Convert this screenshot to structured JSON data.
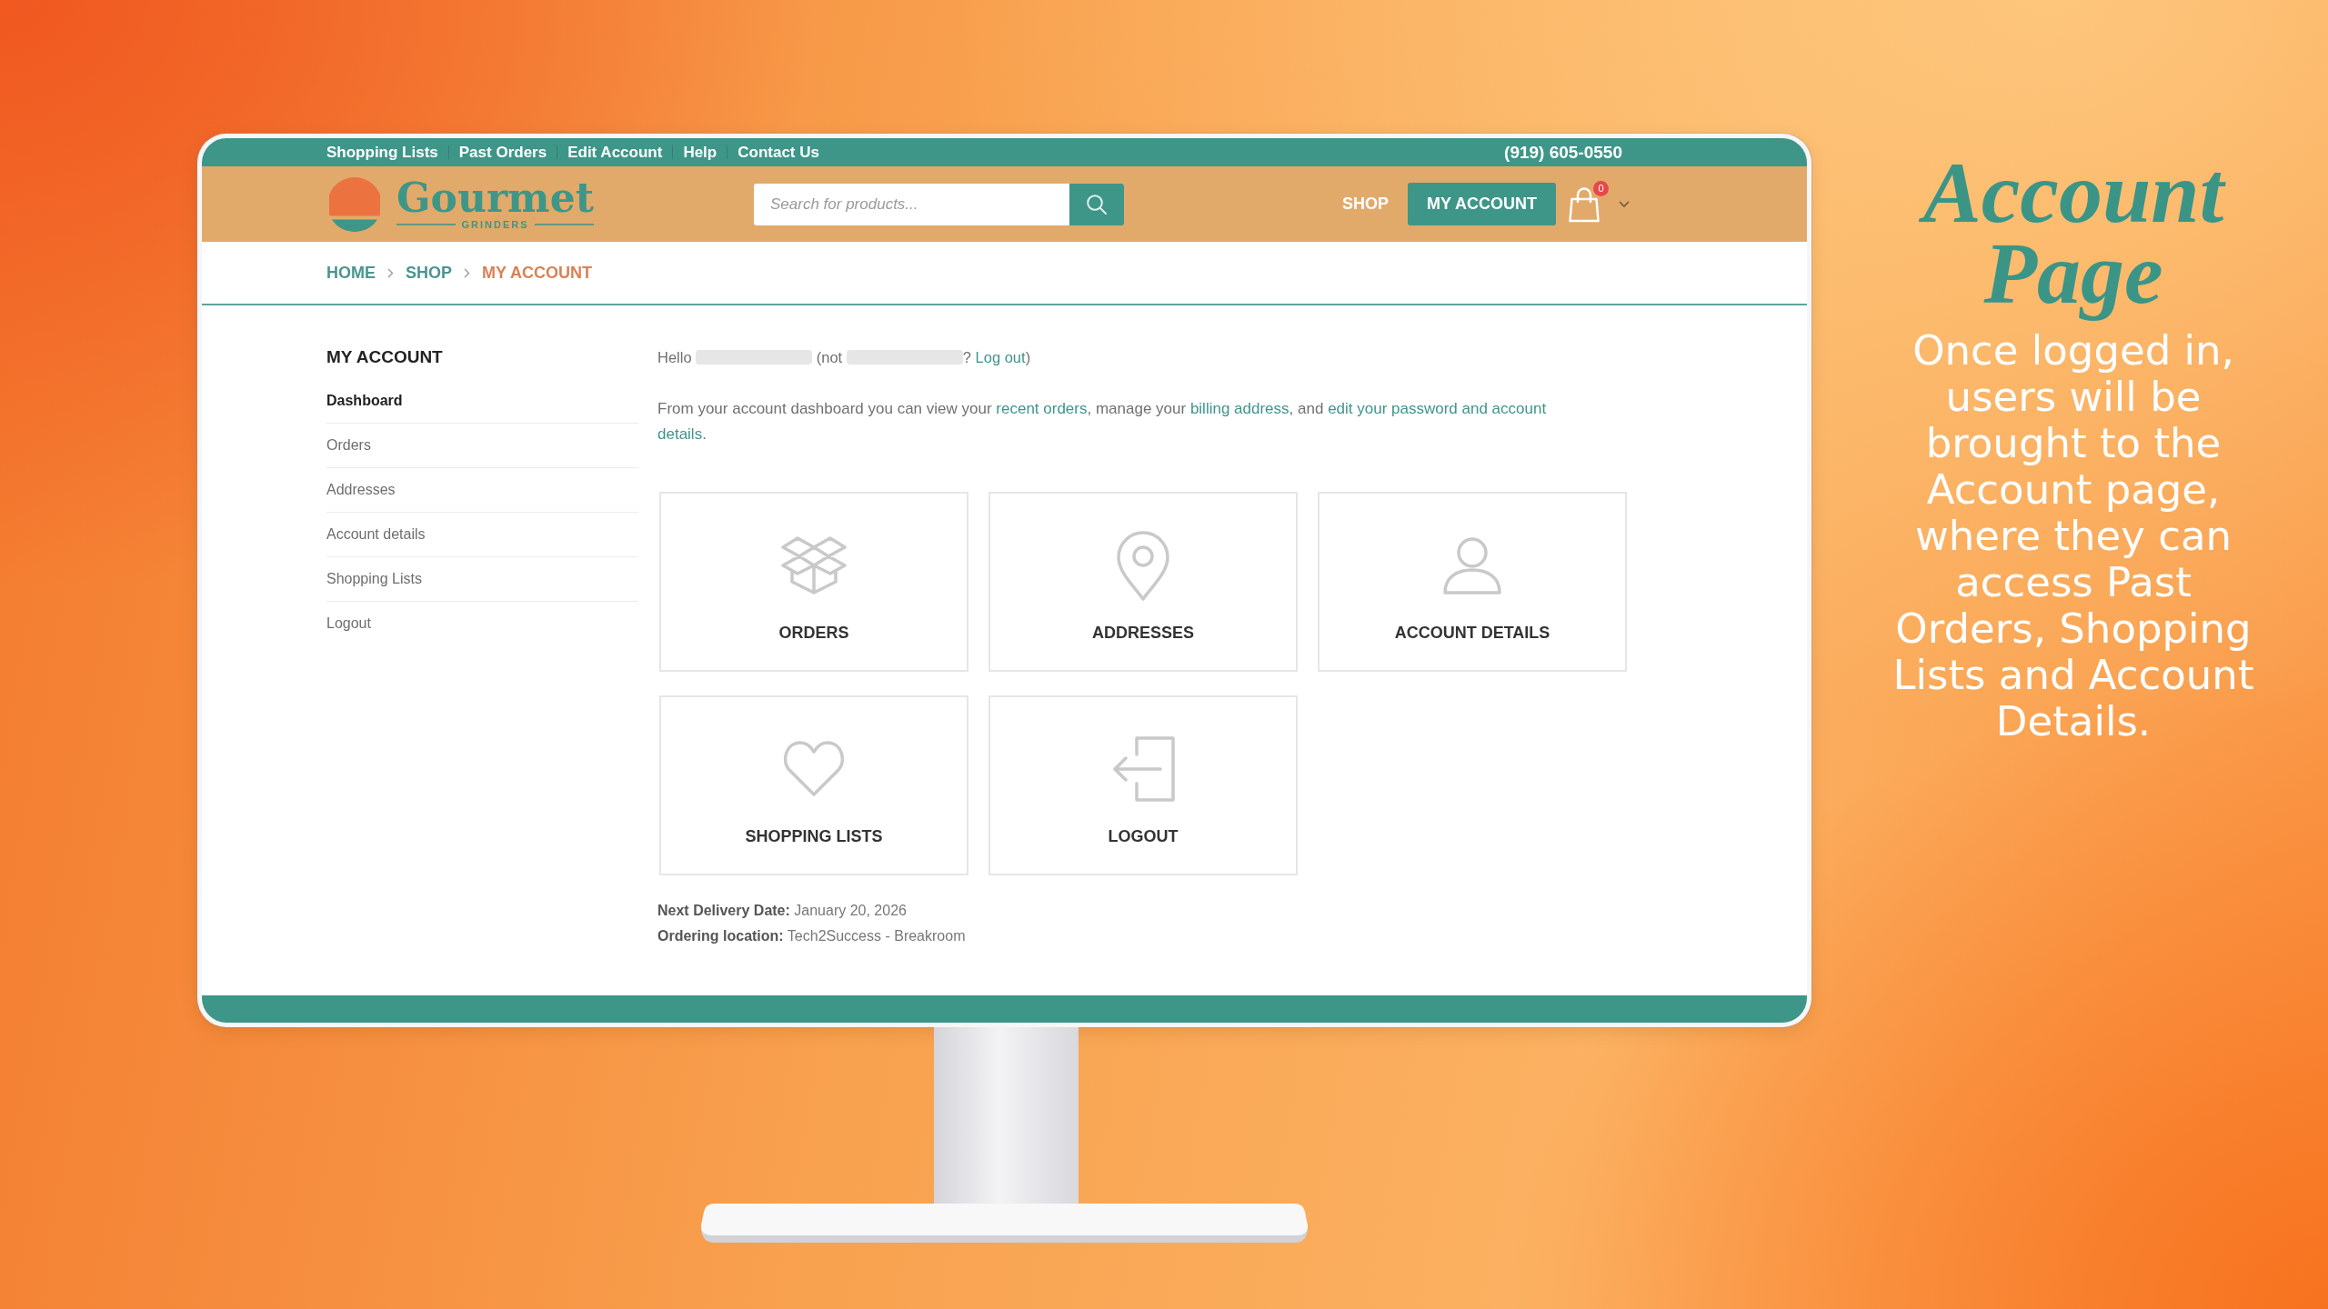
{
  "top_bar": {
    "links": [
      "Shopping Lists",
      "Past Orders",
      "Edit Account",
      "Help",
      "Contact Us"
    ],
    "phone": "(919) 605-0550"
  },
  "header": {
    "logo": {
      "name": "Gourmet",
      "tagline": "GRINDERS"
    },
    "search": {
      "placeholder": "Search for products..."
    },
    "nav": [
      {
        "label": "SHOP",
        "selected": false
      },
      {
        "label": "MY ACCOUNT",
        "selected": true
      }
    ],
    "cart": {
      "count": "0"
    }
  },
  "breadcrumb": [
    {
      "label": "HOME",
      "current": false
    },
    {
      "label": "SHOP",
      "current": false
    },
    {
      "label": "MY ACCOUNT",
      "current": true
    }
  ],
  "sidebar": {
    "title": "MY ACCOUNT",
    "items": [
      {
        "label": "Dashboard",
        "selected": true
      },
      {
        "label": "Orders",
        "selected": false
      },
      {
        "label": "Addresses",
        "selected": false
      },
      {
        "label": "Account details",
        "selected": false
      },
      {
        "label": "Shopping Lists",
        "selected": false
      },
      {
        "label": "Logout",
        "selected": false
      }
    ]
  },
  "greeting": [
    {
      "kind": "text",
      "text": "Hello "
    },
    {
      "kind": "redacted"
    },
    {
      "kind": "text",
      "text": " (not "
    },
    {
      "kind": "redacted"
    },
    {
      "kind": "text",
      "text": "? "
    },
    {
      "kind": "link",
      "text": "Log out"
    },
    {
      "kind": "text",
      "text": ")"
    }
  ],
  "intro": [
    {
      "kind": "text",
      "text": "From your account dashboard you can view your "
    },
    {
      "kind": "link",
      "text": "recent orders"
    },
    {
      "kind": "text",
      "text": ", manage your "
    },
    {
      "kind": "link",
      "text": "billing address"
    },
    {
      "kind": "text",
      "text": ", and "
    },
    {
      "kind": "link",
      "text": "edit your password and account"
    },
    {
      "kind": "link",
      "text": "details"
    },
    {
      "kind": "text",
      "text": "."
    }
  ],
  "tiles": [
    {
      "kind": "orders",
      "label": "ORDERS"
    },
    {
      "kind": "addresses",
      "label": "ADDRESSES"
    },
    {
      "kind": "account",
      "label": "ACCOUNT DETAILS"
    },
    {
      "kind": "lists",
      "label": "SHOPPING LISTS"
    },
    {
      "kind": "logout",
      "label": "LOGOUT"
    }
  ],
  "info": [
    "**Next Delivery Date:** January 20, 2026",
    "**Ordering location:** Tech2Success - Breakroom"
  ],
  "aside": {
    "title": "Account Page",
    "body": "Once logged in, users will be brought to the Account page, where they can access Past Orders, Shopping Lists and Account Details."
  }
}
